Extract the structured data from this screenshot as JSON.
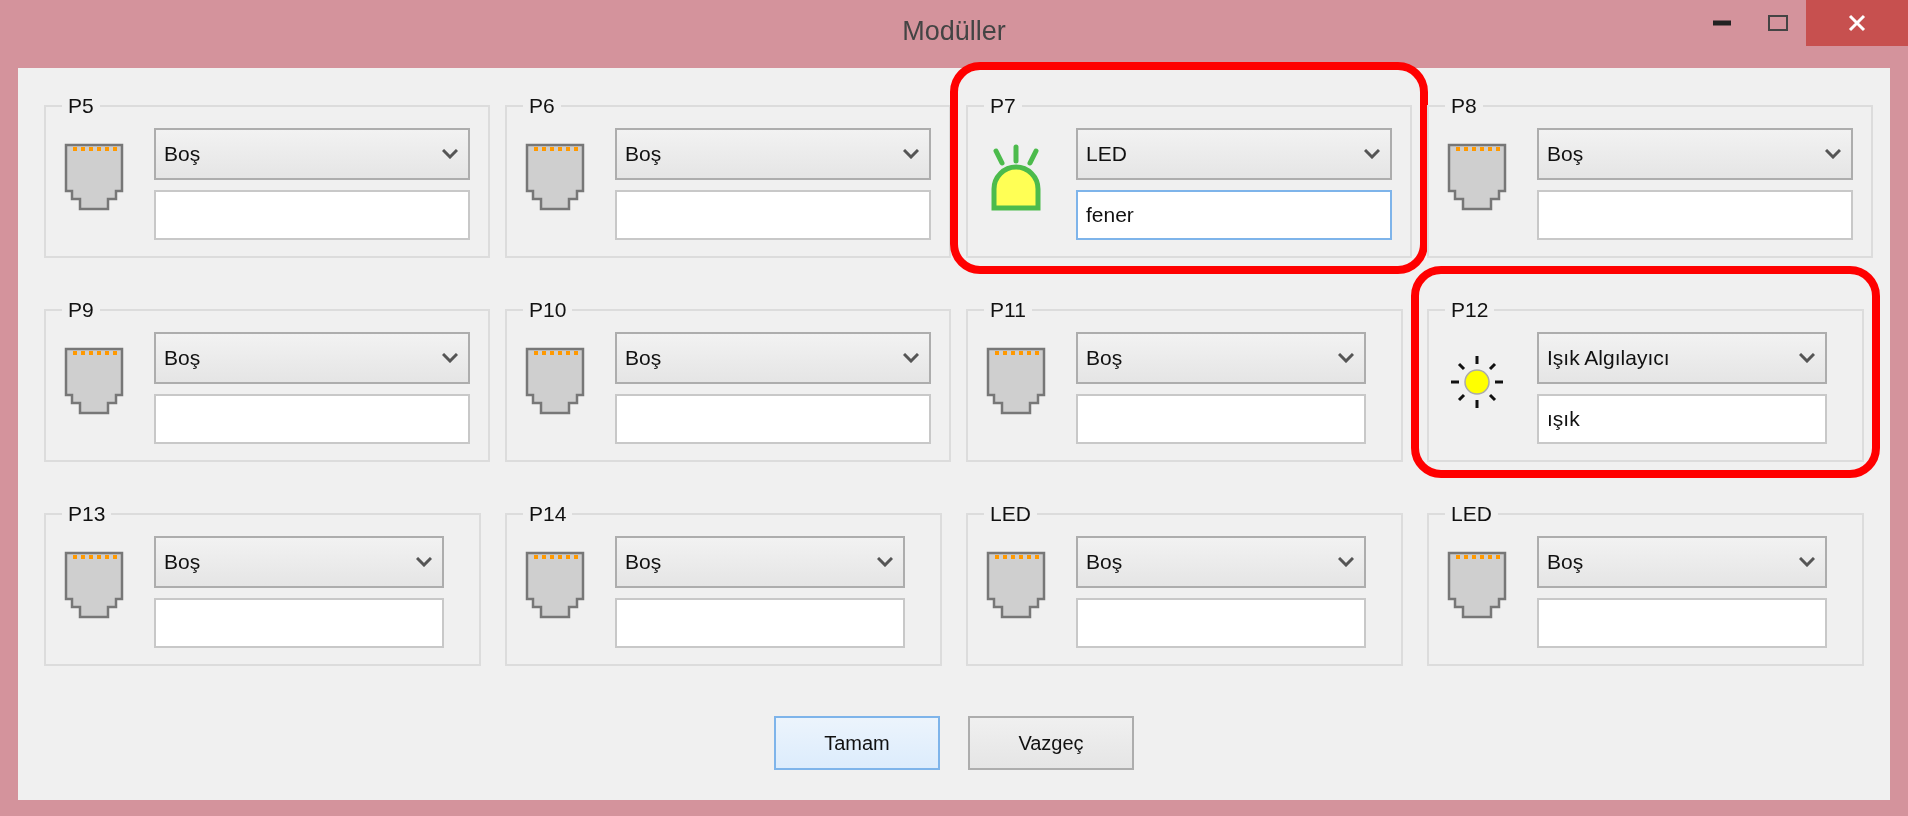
{
  "window": {
    "title": "Modüller"
  },
  "modules": [
    {
      "label": "P5",
      "kind": "socket",
      "selection": "Boş",
      "highlighted": false,
      "focused": false
    },
    {
      "label": "P6",
      "kind": "socket",
      "selection": "Boş",
      "highlighted": false,
      "focused": false
    },
    {
      "label": "P7",
      "kind": "led",
      "selection": "LED",
      "name": "fener",
      "highlighted": true,
      "focused": true
    },
    {
      "label": "P8",
      "kind": "socket",
      "selection": "Boş",
      "highlighted": false,
      "focused": false
    },
    {
      "label": "P9",
      "kind": "socket",
      "selection": "Boş",
      "highlighted": false,
      "focused": false
    },
    {
      "label": "P10",
      "kind": "socket",
      "selection": "Boş",
      "highlighted": false,
      "focused": false
    },
    {
      "label": "P11",
      "kind": "socket",
      "selection": "Boş",
      "highlighted": false,
      "focused": false
    },
    {
      "label": "P12",
      "kind": "light-sensor",
      "selection": "Işık Algılayıcı",
      "name": "ışık",
      "highlighted": true,
      "focused": false
    },
    {
      "label": "P13",
      "kind": "socket",
      "selection": "Boş",
      "highlighted": false,
      "focused": false
    },
    {
      "label": "P14",
      "kind": "socket",
      "selection": "Boş",
      "highlighted": false,
      "focused": false
    },
    {
      "label": "LED",
      "kind": "socket",
      "selection": "Boş",
      "highlighted": false,
      "focused": false
    },
    {
      "label": "LED",
      "kind": "socket",
      "selection": "Boş",
      "highlighted": false,
      "focused": false
    }
  ],
  "buttons": [
    {
      "label": "Tamam",
      "focused": true
    },
    {
      "label": "Vazgeç",
      "focused": false
    }
  ]
}
